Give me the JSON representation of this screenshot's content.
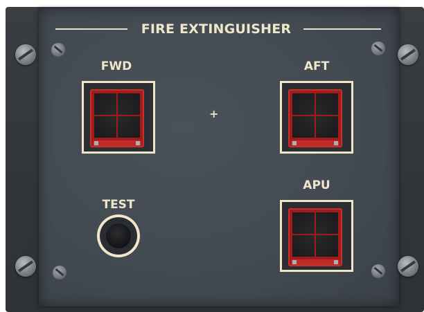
{
  "panel": {
    "title": "FIRE EXTINGUISHER",
    "cross_marker": "+"
  },
  "switches": {
    "fwd": {
      "label": "FWD"
    },
    "aft": {
      "label": "AFT"
    },
    "apu": {
      "label": "APU"
    }
  },
  "test": {
    "label": "TEST"
  },
  "colors": {
    "panel": "#434a52",
    "legend": "#efe7cc",
    "switch_cap": "#a01c1c",
    "guard_border": "#f0e6c8"
  },
  "icons": [
    "screw-icon",
    "small-screw-icon"
  ]
}
